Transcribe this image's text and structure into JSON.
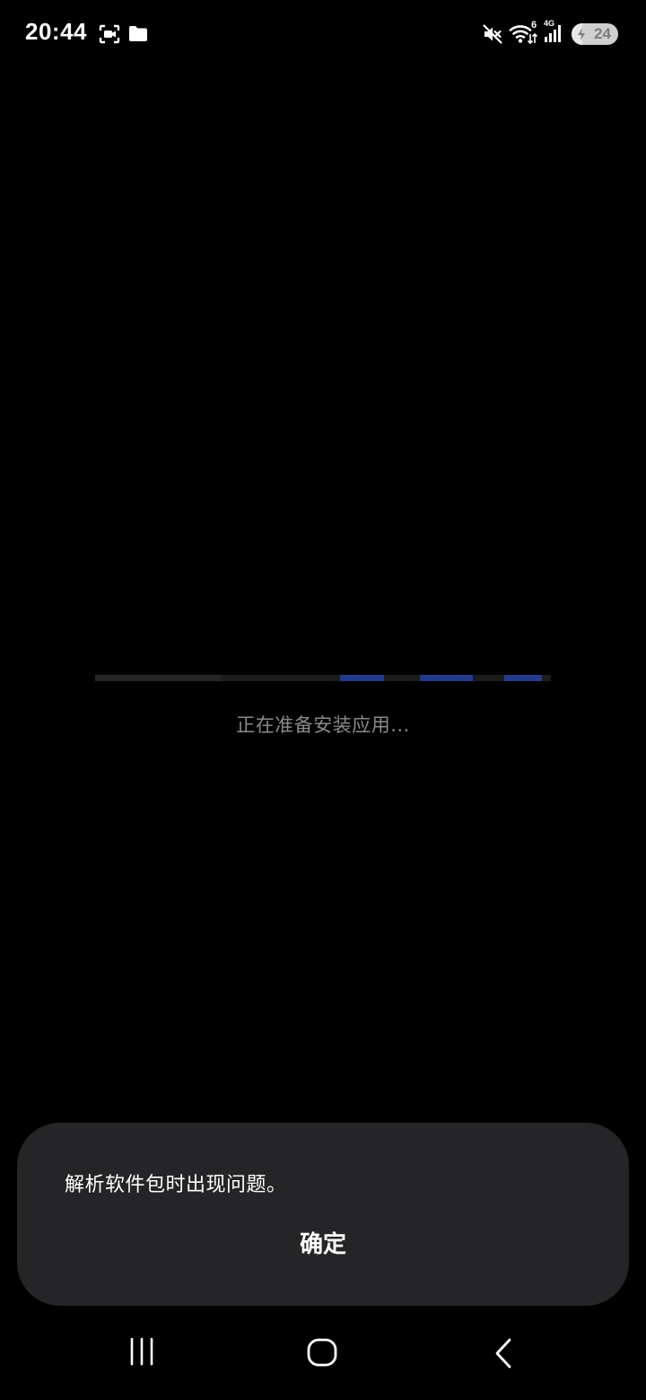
{
  "status_bar": {
    "time": "20:44",
    "left_icons": [
      "screen-recorder-icon",
      "folder-icon"
    ],
    "right_icons": [
      "mute-icon",
      "wifi-icon",
      "signal-icon"
    ],
    "wifi_label": "6",
    "network_label": "4G",
    "battery_level": "24",
    "battery_fraction": 0.24,
    "battery_charging": true
  },
  "installer": {
    "status_text": "正在准备安装应用...",
    "progress_indeterminate": true,
    "progress_color": "#243a8a"
  },
  "dialog": {
    "message": "解析软件包时出现问题。",
    "ok_label": "确定"
  },
  "nav_bar": {
    "buttons": [
      "recent-apps-icon",
      "home-icon",
      "back-icon"
    ]
  },
  "colors": {
    "background": "#000000",
    "dialog_background": "#252527",
    "caption_text": "#8a8a8a",
    "progress_track": "#1c1c1c",
    "progress_accent": "#243a8a"
  }
}
